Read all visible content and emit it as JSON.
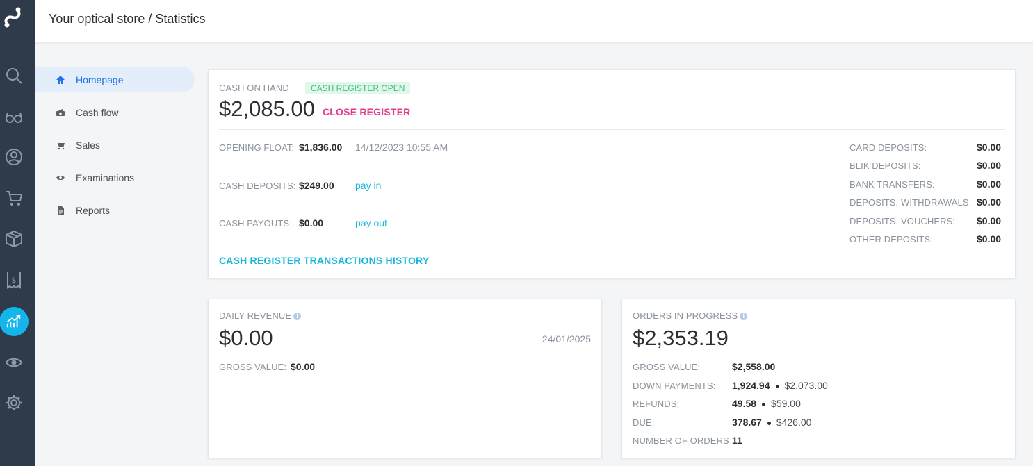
{
  "header": {
    "title": "Your optical store / Statistics"
  },
  "rail": {
    "icons": [
      "logo-icon",
      "search-icon",
      "glasses-icon",
      "user-icon",
      "cart-icon",
      "box-icon",
      "receipt-icon",
      "statistics-icon",
      "eye-icon",
      "gear-icon"
    ],
    "active": "statistics-icon",
    "accent": "#13b5ea"
  },
  "subnav": {
    "items": [
      {
        "label": "Homepage",
        "icon": "home-icon",
        "active": true
      },
      {
        "label": "Cash flow",
        "icon": "cash-icon",
        "active": false
      },
      {
        "label": "Sales",
        "icon": "cart-icon",
        "active": false
      },
      {
        "label": "Examinations",
        "icon": "eye-icon",
        "active": false
      },
      {
        "label": "Reports",
        "icon": "document-icon",
        "active": false
      }
    ]
  },
  "cash_on_hand": {
    "label": "CASH ON HAND",
    "status_badge": "CASH REGISTER OPEN",
    "amount": "$2,085.00",
    "close_button": "CLOSE REGISTER",
    "opening_float_label": "OPENING FLOAT:",
    "opening_float_value": "$1,836.00",
    "opening_datetime": "14/12/2023 10:55 AM",
    "cash_deposits_label": "CASH DEPOSITS:",
    "cash_deposits_value": "$249.00",
    "pay_in": "pay in",
    "cash_payouts_label": "CASH PAYOUTS:",
    "cash_payouts_value": "$0.00",
    "pay_out": "pay out",
    "history_link": "CASH REGISTER TRANSACTIONS HISTORY",
    "deposits": [
      {
        "label": "CARD DEPOSITS:",
        "value": "$0.00"
      },
      {
        "label": "BLIK DEPOSITS:",
        "value": "$0.00"
      },
      {
        "label": "BANK TRANSFERS:",
        "value": "$0.00"
      },
      {
        "label": "DEPOSITS, WITHDRAWALS:",
        "value": "$0.00"
      },
      {
        "label": "DEPOSITS, VOUCHERS:",
        "value": "$0.00"
      },
      {
        "label": "OTHER DEPOSITS:",
        "value": "$0.00"
      }
    ]
  },
  "daily_revenue": {
    "label": "DAILY REVENUE",
    "amount": "$0.00",
    "date": "24/01/2025",
    "gross_label": "GROSS VALUE:",
    "gross_value": "$0.00"
  },
  "orders_in_progress": {
    "label": "ORDERS IN PROGRESS",
    "amount": "$2,353.19",
    "rows": [
      {
        "label": "GROSS VALUE:",
        "value": "$2,558.00",
        "secondary": ""
      },
      {
        "label": "DOWN PAYMENTS:",
        "value": "1,924.94",
        "secondary": "$2,073.00"
      },
      {
        "label": "REFUNDS:",
        "value": "49.58",
        "secondary": "$59.00"
      },
      {
        "label": "DUE:",
        "value": "378.67",
        "secondary": "$426.00"
      },
      {
        "label": "NUMBER OF ORDERS",
        "value": "11",
        "secondary": ""
      }
    ]
  },
  "colors": {
    "rail_bg": "#2f3b4b",
    "accent_link": "#17b7dd",
    "close_register": "#e5398a",
    "badge_text": "#3cc27b",
    "nav_active": "#1a73e8"
  }
}
